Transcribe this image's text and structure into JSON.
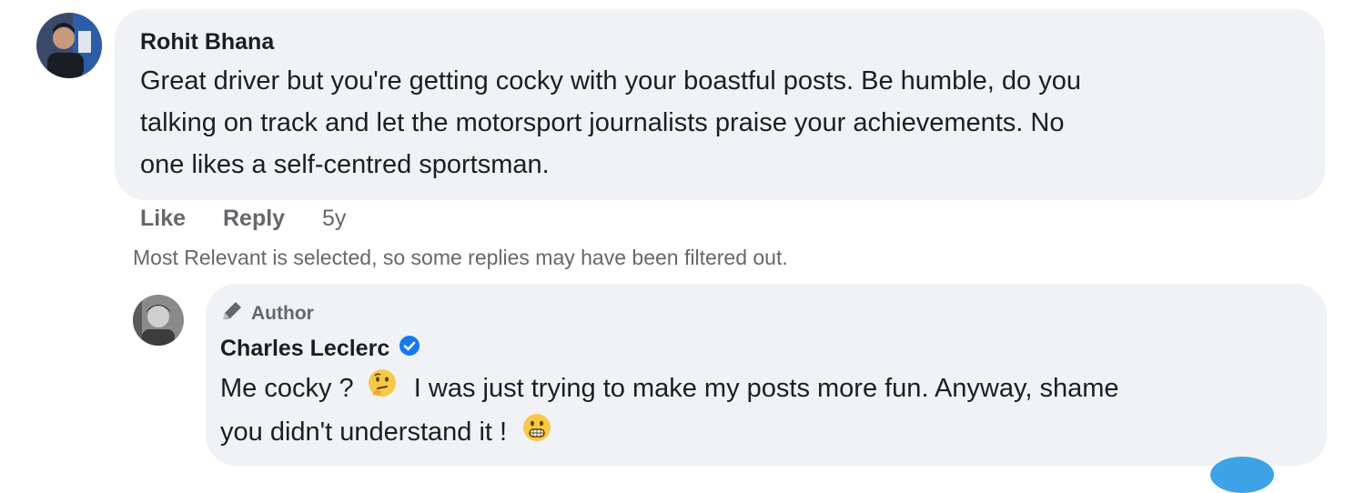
{
  "comment": {
    "author": "Rohit Bhana",
    "text_lines": [
      "Great driver but you're getting cocky with your boastful posts. Be humble, do you",
      "talking on track and let the motorsport journalists praise your achievements. No",
      "one likes a self-centred sportsman."
    ],
    "actions": {
      "like": "Like",
      "reply": "Reply",
      "time": "5y"
    }
  },
  "filter_notice": "Most Relevant is selected, so some replies may have been filtered out.",
  "reply": {
    "badge": "Author",
    "author": "Charles Leclerc",
    "verified": true,
    "line1_a": "Me cocky ?",
    "line1_b": "I was just trying to make my posts more fun. Anyway, shame",
    "line2": "you didn't understand it !",
    "emoji1": "thinking-face",
    "emoji2": "grinning-face"
  },
  "colors": {
    "bubble": "#f0f2f5",
    "text": "#1c1e21",
    "secondary": "#65676b",
    "verified": "#1877f2"
  }
}
